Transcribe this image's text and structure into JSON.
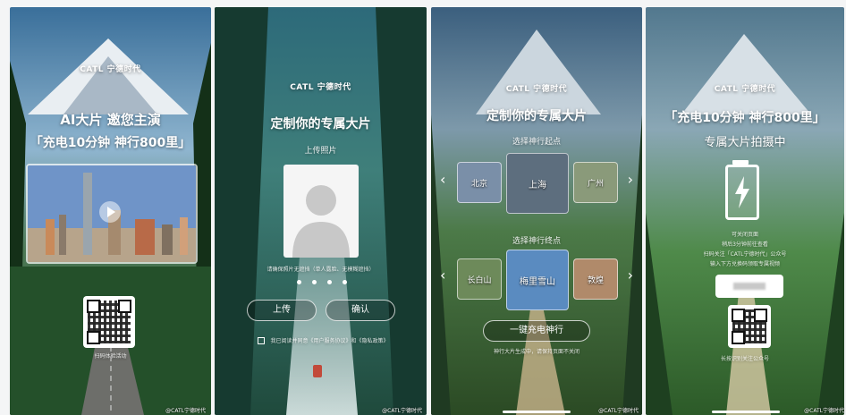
{
  "brand": {
    "logo": "CATL 宁德时代",
    "watermark": "@CATL宁德时代"
  },
  "screen1": {
    "title": "AI大片  邀您主演",
    "subtitle": "「充电10分钟 神行800里」",
    "qr_caption": "扫码体验活动"
  },
  "screen2": {
    "title": "定制你的专属大片",
    "upload_label": "上传照片",
    "hint": "请确保照片无遮挡（单人露脸、无模糊遮挡）",
    "upload_button": "上传",
    "confirm_button": "确认",
    "agreement": "我已阅读并同意《用户服务协议》和《隐私政策》"
  },
  "screen3": {
    "title": "定制你的专属大片",
    "start_label": "选择神行起点",
    "end_label": "选择神行终点",
    "start_cities": [
      "北京",
      "上海",
      "广州"
    ],
    "end_cities": [
      "长白山",
      "梅里雪山",
      "敦煌"
    ],
    "action_button": "一键充电神行",
    "note": "神行大片生成中，请保持页面不关闭"
  },
  "screen4": {
    "subtitle": "「充电10分钟 神行800里」",
    "title": "专属大片拍摄中",
    "line1": "可关闭页面",
    "line2": "稍后3分钟前往查看",
    "line3": "扫码关注「CATL宁德时代」公众号",
    "line4": "输入下方兑换码领取专属视频",
    "qr_caption": "长按识别关注公众号"
  },
  "icons": [
    "play-icon",
    "bolt-icon",
    "chevron-left-icon",
    "chevron-right-icon",
    "avatar-placeholder-icon",
    "checkbox-icon"
  ]
}
